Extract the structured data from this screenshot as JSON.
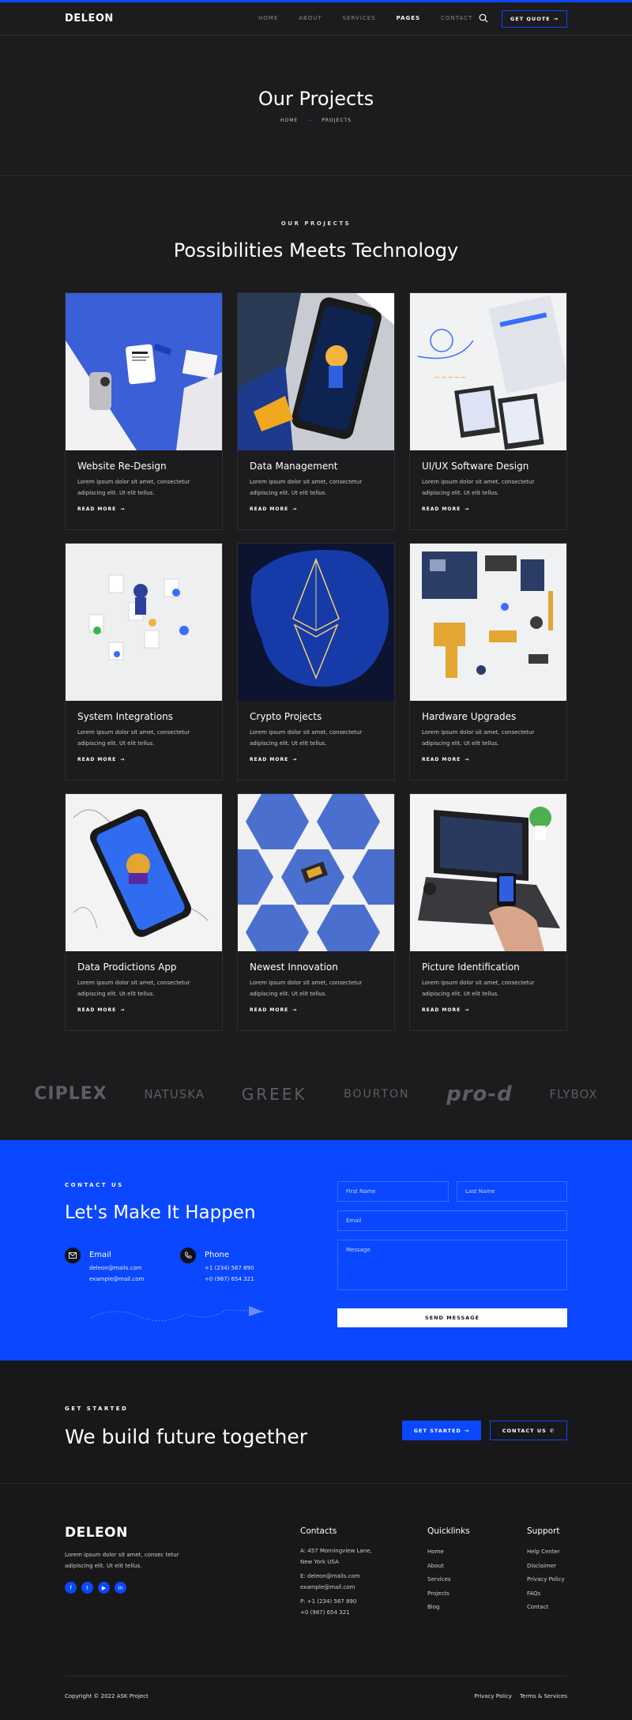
{
  "brand": {
    "name": "DELEON",
    "accent": "#0a47ff"
  },
  "nav": {
    "items": [
      {
        "label": "HOME",
        "active": false
      },
      {
        "label": "ABOUT",
        "active": false
      },
      {
        "label": "SERVICES",
        "active": false
      },
      {
        "label": "PAGES",
        "active": true
      },
      {
        "label": "CONTACT",
        "active": false
      }
    ],
    "search_icon": "search-icon",
    "quote_label": "GET QUOTE"
  },
  "hero": {
    "title": "Our Projects",
    "breadcrumb": [
      "HOME",
      "PROJECTS"
    ]
  },
  "projects": {
    "eyebrow": "OUR PROJECTS",
    "title": "Possibilities Meets Technology",
    "read_more": "READ MORE",
    "description": "Lorem ipsum dolor sit amet, consectetur adipiscing elit. Ut elit tellus.",
    "items": [
      {
        "title": "Website Re-Design"
      },
      {
        "title": "Data Management"
      },
      {
        "title": "UI/UX Software Design"
      },
      {
        "title": "System Integrations"
      },
      {
        "title": "Crypto Projects"
      },
      {
        "title": "Hardware Upgrades"
      },
      {
        "title": "Data Prodictions App"
      },
      {
        "title": "Newest Innovation"
      },
      {
        "title": "Picture Identification"
      }
    ]
  },
  "partners": [
    "CIPLEX",
    "NATUSKA",
    "GREEK",
    "BOURTON",
    "pro-d",
    "FLYBOX"
  ],
  "contact": {
    "eyebrow": "CONTACT US",
    "title": "Let's Make It Happen",
    "email_label": "Email",
    "emails": [
      "deleon@mails.com",
      "example@mail.com"
    ],
    "phone_label": "Phone",
    "phones": [
      "+1 (234) 567 890",
      "+0 (987) 654 321"
    ],
    "form": {
      "first_name": "First Name",
      "last_name": "Last Name",
      "email": "Email",
      "message": "Message",
      "submit": "SEND MESSAGE"
    }
  },
  "cta": {
    "eyebrow": "GET STARTED",
    "title": "We build future together",
    "start_label": "GET STARTED",
    "contact_label": "CONTACT US"
  },
  "footer": {
    "logo": "DELEON",
    "description": "Lorem ipsum dolor sit amet, consec tetur adipiscing elit. Ut elit tellus.",
    "socials": [
      "facebook-icon",
      "twitter-icon",
      "youtube-icon",
      "linkedin-icon"
    ],
    "contacts": {
      "title": "Contacts",
      "address_line1": "A: 457 Morningview Lane,",
      "address_line2": "New York USA",
      "email_line1": "E: deleon@mails.com",
      "email_line2": "example@mail.com",
      "phone_line1": "P: +1 (234) 567 890",
      "phone_line2": "+0 (987) 654 321"
    },
    "quicklinks": {
      "title": "Quicklinks",
      "items": [
        "Home",
        "About",
        "Services",
        "Projects",
        "Blog"
      ]
    },
    "support": {
      "title": "Support",
      "items": [
        "Help Center",
        "Disclaimer",
        "Privacy Policy",
        "FAQs",
        "Contact"
      ]
    },
    "copyright": "Copyright © 2022 ASK Project",
    "legal": [
      "Privacy Policy",
      "Terms & Services"
    ]
  }
}
